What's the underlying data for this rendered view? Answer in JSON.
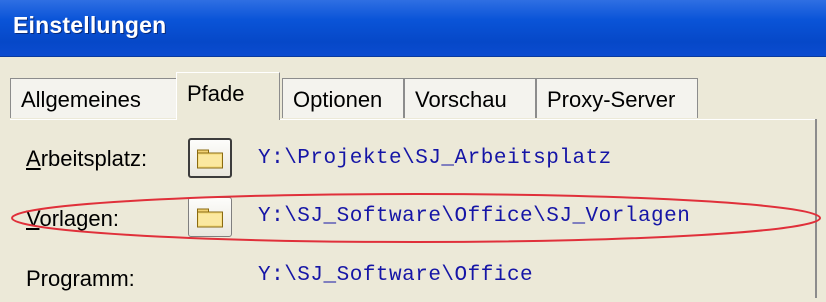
{
  "window": {
    "title": "Einstellungen"
  },
  "tabs": [
    {
      "label": "Allgemeines",
      "active": false
    },
    {
      "label": "Pfade",
      "active": true
    },
    {
      "label": "Optionen",
      "active": false
    },
    {
      "label": "Vorschau",
      "active": false
    },
    {
      "label": "Proxy-Server",
      "active": false
    }
  ],
  "paths": [
    {
      "label": "Arbeitsplatz:",
      "mnemonic": "A",
      "rest": "rbeitsplatz:",
      "value": "Y:\\Projekte\\SJ_Arbeitsplatz",
      "has_button": true,
      "button_icon": "folder-icon"
    },
    {
      "label": "Vorlagen:",
      "mnemonic": "V",
      "rest": "orlagen:",
      "value": "Y:\\SJ_Software\\Office\\SJ_Vorlagen",
      "has_button": true,
      "button_icon": "folder-icon",
      "highlighted": true
    },
    {
      "label": "Programm:",
      "value": "Y:\\SJ_Software\\Office",
      "has_button": false
    }
  ],
  "colors": {
    "titlebar": "#0a54d8",
    "path_text": "#1515a6",
    "highlight_ellipse": "#e0303a"
  }
}
